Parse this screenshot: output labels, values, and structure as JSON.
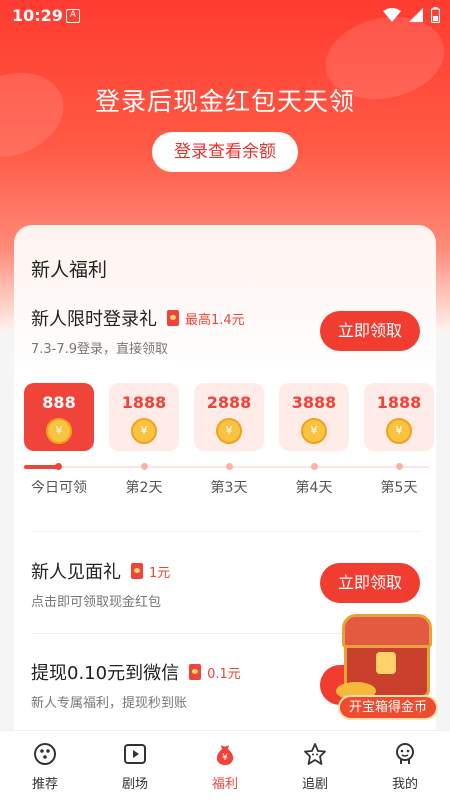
{
  "status_bar": {
    "time": "10:29",
    "notification_letter": "A"
  },
  "hero": {
    "title": "登录后现金红包天天领",
    "login_button": "登录查看余额"
  },
  "newcomer": {
    "section_title": "新人福利",
    "login_gift": {
      "title": "新人限时登录礼",
      "badge": "最高1.4元",
      "subtitle": "7.3-7.9登录，直接领取",
      "button": "立即领取"
    },
    "days": [
      {
        "amount": "888",
        "label": "今日可领",
        "active": true
      },
      {
        "amount": "1888",
        "label": "第2天",
        "active": false
      },
      {
        "amount": "2888",
        "label": "第3天",
        "active": false
      },
      {
        "amount": "3888",
        "label": "第4天",
        "active": false
      },
      {
        "amount": "1888",
        "label": "第5天",
        "active": false
      }
    ],
    "meet_gift": {
      "title": "新人见面礼",
      "badge": "1元",
      "subtitle": "点击即可领取现金红包",
      "button": "立即领取"
    },
    "withdraw": {
      "title": "提现0.10元到微信",
      "badge": "0.1元",
      "subtitle": "新人专属福利，提现秒到账"
    }
  },
  "treasure_chest": {
    "label": "开宝箱得金币"
  },
  "tabbar": {
    "items": [
      {
        "label": "推荐",
        "icon": "recommend-icon"
      },
      {
        "label": "剧场",
        "icon": "theater-icon"
      },
      {
        "label": "福利",
        "icon": "welfare-icon",
        "active": true
      },
      {
        "label": "追剧",
        "icon": "follow-icon"
      },
      {
        "label": "我的",
        "icon": "profile-icon"
      }
    ]
  },
  "colors": {
    "accent": "#f0443a",
    "hero_top": "#ff3b30",
    "coin": "#f8c340"
  }
}
